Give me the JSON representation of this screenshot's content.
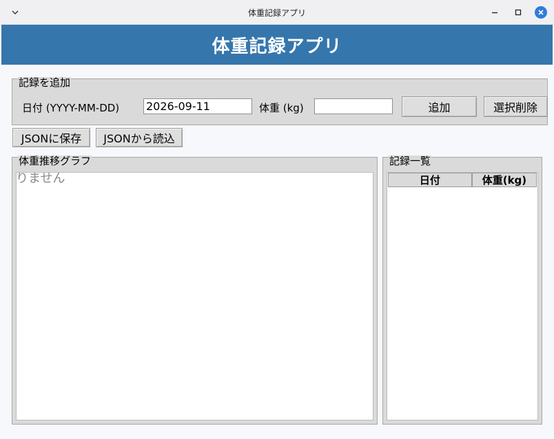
{
  "window": {
    "title": "体重記録アプリ"
  },
  "header": {
    "title": "体重記録アプリ"
  },
  "add_record": {
    "legend": "記録を追加",
    "date_label": "日付 (YYYY-MM-DD)",
    "date_value": "2026-09-11",
    "weight_label": "体重 (kg)",
    "weight_value": "",
    "add_button": "追加",
    "delete_button": "選択削除"
  },
  "toolbar": {
    "save_json": "JSONに保存",
    "load_json": "JSONから読込"
  },
  "graph": {
    "legend": "体重推移グラフ",
    "empty_message": "りません"
  },
  "records": {
    "legend": "記録一覧",
    "columns": [
      "日付",
      "体重(kg)"
    ],
    "rows": []
  },
  "colors": {
    "header_bg": "#3576ad",
    "close_button": "#2f7bdc",
    "group_bg": "#dadada"
  }
}
